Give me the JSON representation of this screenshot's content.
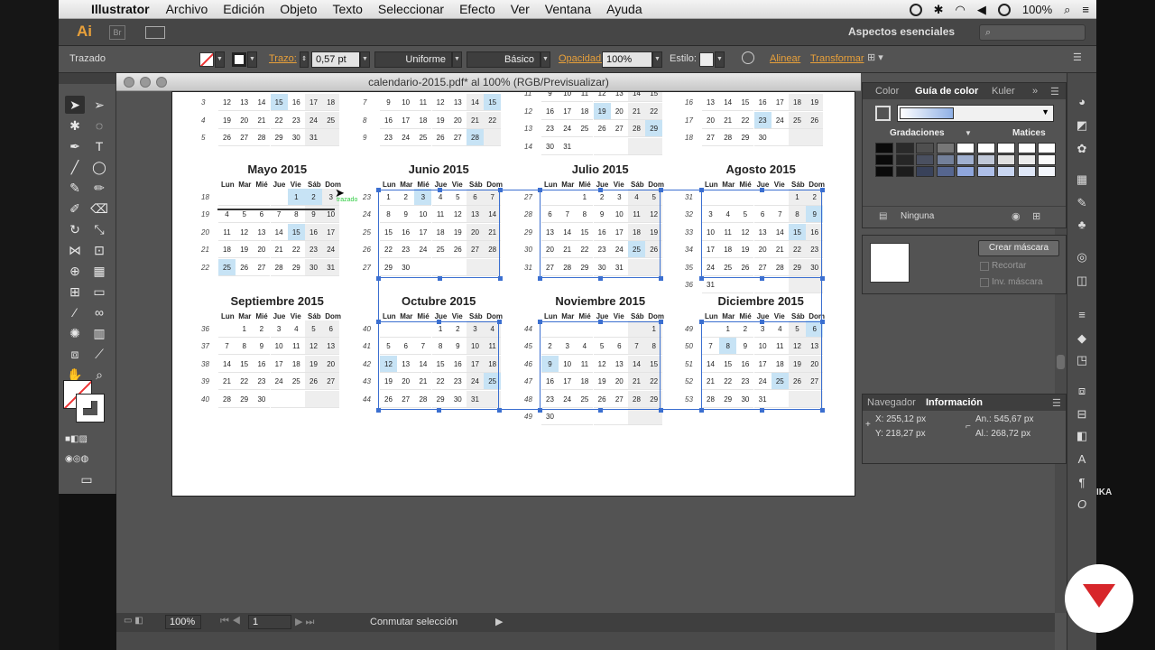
{
  "menubar": {
    "app": "Illustrator",
    "items": [
      "Archivo",
      "Edición",
      "Objeto",
      "Texto",
      "Seleccionar",
      "Efecto",
      "Ver",
      "Ventana",
      "Ayuda"
    ],
    "battery": "100%"
  },
  "appbar": {
    "logo": "Ai",
    "bridge": "Br",
    "workspace": "Aspectos esenciales"
  },
  "control": {
    "selection_label": "Trazado",
    "stroke_label": "Trazo:",
    "stroke_weight": "0,57 pt",
    "profile": "Uniforme",
    "brush": "Básico",
    "opacity_label": "Opacidad:",
    "opacity": "100%",
    "style_label": "Estilo:",
    "align": "Alinear",
    "transform": "Transformar"
  },
  "document": {
    "title": "calendario-2015.pdf* al 100% (RGB/Previsualizar)"
  },
  "status": {
    "zoom": "100%",
    "page": "1",
    "message": "Conmutar selección"
  },
  "annotation": "trazado",
  "day_headers": [
    "Lun",
    "Mar",
    "Mié",
    "Jue",
    "Vie",
    "Sáb",
    "Dom"
  ],
  "top_fragments": [
    {
      "weeks": [
        "3",
        "4",
        "5"
      ],
      "rows": [
        [
          "",
          "12",
          "13",
          "14",
          "15",
          "16",
          "17",
          "18"
        ],
        [
          "",
          "19",
          "20",
          "21",
          "22",
          "23",
          "24",
          "25"
        ],
        [
          "",
          "26",
          "27",
          "28",
          "29",
          "30",
          "31",
          ""
        ]
      ]
    },
    {
      "weeks": [
        "7",
        "8",
        "9"
      ],
      "rows": [
        [
          "",
          "9",
          "10",
          "11",
          "12",
          "13",
          "14",
          "15"
        ],
        [
          "",
          "16",
          "17",
          "18",
          "19",
          "20",
          "21",
          "22"
        ],
        [
          "",
          "23",
          "24",
          "25",
          "26",
          "27",
          "28",
          ""
        ]
      ]
    },
    {
      "weeks": [
        "11",
        "12",
        "13",
        "14"
      ],
      "rows": [
        [
          "",
          "9",
          "10",
          "11",
          "12",
          "13",
          "14",
          "15"
        ],
        [
          "",
          "16",
          "17",
          "18",
          "19",
          "20",
          "21",
          "22"
        ],
        [
          "",
          "23",
          "24",
          "25",
          "26",
          "27",
          "28",
          "29"
        ],
        [
          "",
          "30",
          "31",
          "",
          "",
          "",
          "",
          ""
        ]
      ]
    },
    {
      "weeks": [
        "16",
        "17",
        "18"
      ],
      "rows": [
        [
          "",
          "13",
          "14",
          "15",
          "16",
          "17",
          "18",
          "19"
        ],
        [
          "",
          "20",
          "21",
          "22",
          "23",
          "24",
          "25",
          "26"
        ],
        [
          "",
          "27",
          "28",
          "29",
          "30",
          "",
          "",
          ""
        ]
      ]
    }
  ],
  "months": [
    {
      "title": "Mayo 2015",
      "weeks": [
        "18",
        "19",
        "20",
        "21",
        "22"
      ],
      "rows": [
        [
          "",
          "",
          "",
          "",
          "1",
          "2",
          "3"
        ],
        [
          "4",
          "5",
          "6",
          "7",
          "8",
          "9",
          "10"
        ],
        [
          "11",
          "12",
          "13",
          "14",
          "15",
          "16",
          "17"
        ],
        [
          "18",
          "19",
          "20",
          "21",
          "22",
          "23",
          "24"
        ],
        [
          "25",
          "26",
          "27",
          "28",
          "29",
          "30",
          "31"
        ]
      ]
    },
    {
      "title": "Junio 2015",
      "weeks": [
        "23",
        "24",
        "25",
        "26",
        "27"
      ],
      "rows": [
        [
          "1",
          "2",
          "3",
          "4",
          "5",
          "6",
          "7"
        ],
        [
          "8",
          "9",
          "10",
          "11",
          "12",
          "13",
          "14"
        ],
        [
          "15",
          "16",
          "17",
          "18",
          "19",
          "20",
          "21"
        ],
        [
          "22",
          "23",
          "24",
          "25",
          "26",
          "27",
          "28"
        ],
        [
          "29",
          "30",
          "",
          "",
          "",
          "",
          ""
        ]
      ]
    },
    {
      "title": "Julio 2015",
      "weeks": [
        "27",
        "28",
        "29",
        "30",
        "31"
      ],
      "rows": [
        [
          "",
          "",
          "1",
          "2",
          "3",
          "4",
          "5"
        ],
        [
          "6",
          "7",
          "8",
          "9",
          "10",
          "11",
          "12"
        ],
        [
          "13",
          "14",
          "15",
          "16",
          "17",
          "18",
          "19"
        ],
        [
          "20",
          "21",
          "22",
          "23",
          "24",
          "25",
          "26"
        ],
        [
          "27",
          "28",
          "29",
          "30",
          "31",
          "",
          ""
        ]
      ]
    },
    {
      "title": "Agosto 2015",
      "weeks": [
        "31",
        "32",
        "33",
        "34",
        "35",
        "36"
      ],
      "rows": [
        [
          "",
          "",
          "",
          "",
          "",
          "1",
          "2"
        ],
        [
          "3",
          "4",
          "5",
          "6",
          "7",
          "8",
          "9"
        ],
        [
          "10",
          "11",
          "12",
          "13",
          "14",
          "15",
          "16"
        ],
        [
          "17",
          "18",
          "19",
          "20",
          "21",
          "22",
          "23"
        ],
        [
          "24",
          "25",
          "26",
          "27",
          "28",
          "29",
          "30"
        ],
        [
          "31",
          "",
          "",
          "",
          "",
          "",
          ""
        ]
      ]
    },
    {
      "title": "Septiembre 2015",
      "weeks": [
        "36",
        "37",
        "38",
        "39",
        "40"
      ],
      "rows": [
        [
          "",
          "1",
          "2",
          "3",
          "4",
          "5",
          "6"
        ],
        [
          "7",
          "8",
          "9",
          "10",
          "11",
          "12",
          "13"
        ],
        [
          "14",
          "15",
          "16",
          "17",
          "18",
          "19",
          "20"
        ],
        [
          "21",
          "22",
          "23",
          "24",
          "25",
          "26",
          "27"
        ],
        [
          "28",
          "29",
          "30",
          "",
          "",
          "",
          ""
        ]
      ]
    },
    {
      "title": "Octubre 2015",
      "weeks": [
        "40",
        "41",
        "42",
        "43",
        "44"
      ],
      "rows": [
        [
          "",
          "",
          "",
          "1",
          "2",
          "3",
          "4"
        ],
        [
          "5",
          "6",
          "7",
          "8",
          "9",
          "10",
          "11"
        ],
        [
          "12",
          "13",
          "14",
          "15",
          "16",
          "17",
          "18"
        ],
        [
          "19",
          "20",
          "21",
          "22",
          "23",
          "24",
          "25"
        ],
        [
          "26",
          "27",
          "28",
          "29",
          "30",
          "31",
          ""
        ]
      ]
    },
    {
      "title": "Noviembre 2015",
      "weeks": [
        "44",
        "45",
        "46",
        "47",
        "48",
        "49"
      ],
      "rows": [
        [
          "",
          "",
          "",
          "",
          "",
          "",
          "1"
        ],
        [
          "2",
          "3",
          "4",
          "5",
          "6",
          "7",
          "8"
        ],
        [
          "9",
          "10",
          "11",
          "12",
          "13",
          "14",
          "15"
        ],
        [
          "16",
          "17",
          "18",
          "19",
          "20",
          "21",
          "22"
        ],
        [
          "23",
          "24",
          "25",
          "26",
          "27",
          "28",
          "29"
        ],
        [
          "30",
          "",
          "",
          "",
          "",
          "",
          ""
        ]
      ]
    },
    {
      "title": "Diciembre 2015",
      "weeks": [
        "49",
        "50",
        "51",
        "52",
        "53"
      ],
      "rows": [
        [
          "",
          "1",
          "2",
          "3",
          "4",
          "5",
          "6"
        ],
        [
          "7",
          "8",
          "9",
          "10",
          "11",
          "12",
          "13"
        ],
        [
          "14",
          "15",
          "16",
          "17",
          "18",
          "19",
          "20"
        ],
        [
          "21",
          "22",
          "23",
          "24",
          "25",
          "26",
          "27"
        ],
        [
          "28",
          "29",
          "30",
          "31",
          "",
          "",
          ""
        ]
      ]
    }
  ],
  "highlights": {
    "0": [
      "1",
      "2",
      "15",
      "25"
    ],
    "1": [
      "3"
    ],
    "2": [
      "25"
    ],
    "3": [
      "9",
      "15"
    ],
    "5": [
      "12",
      "25"
    ],
    "6": [
      "9"
    ],
    "7": [
      "8",
      "6",
      "25"
    ]
  },
  "top_highlights": {
    "0": [
      "15"
    ],
    "1": [
      "15",
      "28"
    ],
    "2": [
      "19",
      "29"
    ],
    "3": [
      "23"
    ]
  },
  "color_panel": {
    "tabs": [
      "Color",
      "Guía de color",
      "Kuler"
    ],
    "gradations": "Gradaciones",
    "shades": "Matices",
    "none": "Ninguna"
  },
  "mask_panel": {
    "create": "Crear máscara",
    "clip": "Recortar",
    "invert": "Inv. máscara"
  },
  "info_panel": {
    "tabs": [
      "Navegador",
      "Información"
    ],
    "x": "X: 255,12 px",
    "y": "Y: 218,27 px",
    "w": "An.: 545,67 px",
    "h": "Al.: 268,72 px"
  },
  "side_label": "IKA",
  "colors": {
    "highlight": "#c7e3f5",
    "selection": "#3b6fd0",
    "accent": "#e8a03a"
  }
}
